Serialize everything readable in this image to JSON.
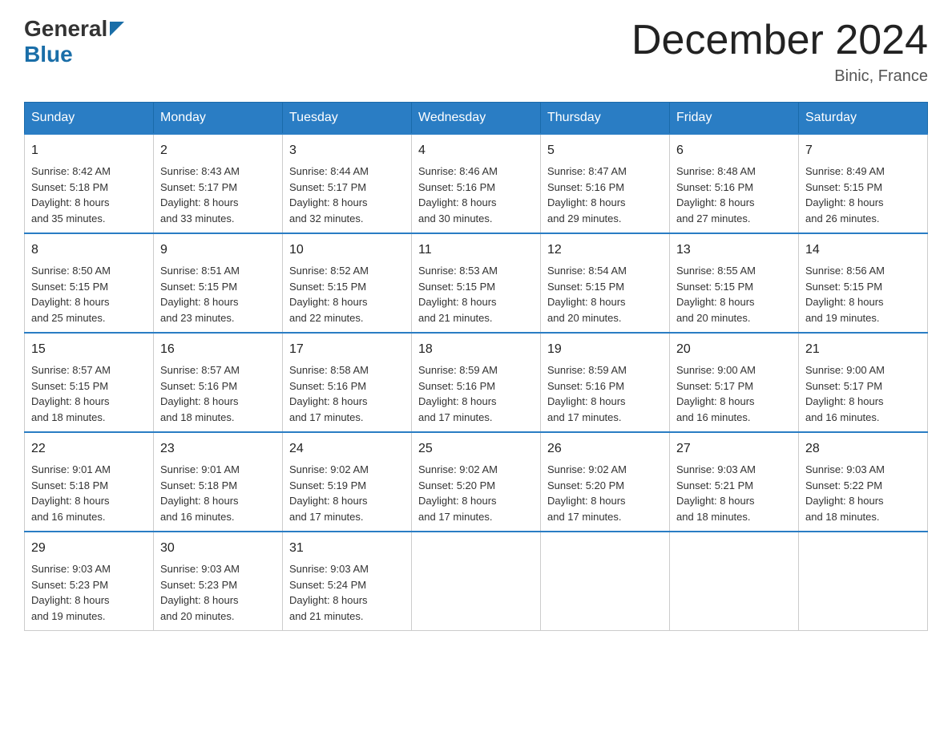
{
  "logo": {
    "general": "General",
    "blue": "Blue"
  },
  "title": "December 2024",
  "location": "Binic, France",
  "days_of_week": [
    "Sunday",
    "Monday",
    "Tuesday",
    "Wednesday",
    "Thursday",
    "Friday",
    "Saturday"
  ],
  "weeks": [
    [
      {
        "day": "1",
        "sunrise": "Sunrise: 8:42 AM",
        "sunset": "Sunset: 5:18 PM",
        "daylight": "Daylight: 8 hours",
        "daylight2": "and 35 minutes."
      },
      {
        "day": "2",
        "sunrise": "Sunrise: 8:43 AM",
        "sunset": "Sunset: 5:17 PM",
        "daylight": "Daylight: 8 hours",
        "daylight2": "and 33 minutes."
      },
      {
        "day": "3",
        "sunrise": "Sunrise: 8:44 AM",
        "sunset": "Sunset: 5:17 PM",
        "daylight": "Daylight: 8 hours",
        "daylight2": "and 32 minutes."
      },
      {
        "day": "4",
        "sunrise": "Sunrise: 8:46 AM",
        "sunset": "Sunset: 5:16 PM",
        "daylight": "Daylight: 8 hours",
        "daylight2": "and 30 minutes."
      },
      {
        "day": "5",
        "sunrise": "Sunrise: 8:47 AM",
        "sunset": "Sunset: 5:16 PM",
        "daylight": "Daylight: 8 hours",
        "daylight2": "and 29 minutes."
      },
      {
        "day": "6",
        "sunrise": "Sunrise: 8:48 AM",
        "sunset": "Sunset: 5:16 PM",
        "daylight": "Daylight: 8 hours",
        "daylight2": "and 27 minutes."
      },
      {
        "day": "7",
        "sunrise": "Sunrise: 8:49 AM",
        "sunset": "Sunset: 5:15 PM",
        "daylight": "Daylight: 8 hours",
        "daylight2": "and 26 minutes."
      }
    ],
    [
      {
        "day": "8",
        "sunrise": "Sunrise: 8:50 AM",
        "sunset": "Sunset: 5:15 PM",
        "daylight": "Daylight: 8 hours",
        "daylight2": "and 25 minutes."
      },
      {
        "day": "9",
        "sunrise": "Sunrise: 8:51 AM",
        "sunset": "Sunset: 5:15 PM",
        "daylight": "Daylight: 8 hours",
        "daylight2": "and 23 minutes."
      },
      {
        "day": "10",
        "sunrise": "Sunrise: 8:52 AM",
        "sunset": "Sunset: 5:15 PM",
        "daylight": "Daylight: 8 hours",
        "daylight2": "and 22 minutes."
      },
      {
        "day": "11",
        "sunrise": "Sunrise: 8:53 AM",
        "sunset": "Sunset: 5:15 PM",
        "daylight": "Daylight: 8 hours",
        "daylight2": "and 21 minutes."
      },
      {
        "day": "12",
        "sunrise": "Sunrise: 8:54 AM",
        "sunset": "Sunset: 5:15 PM",
        "daylight": "Daylight: 8 hours",
        "daylight2": "and 20 minutes."
      },
      {
        "day": "13",
        "sunrise": "Sunrise: 8:55 AM",
        "sunset": "Sunset: 5:15 PM",
        "daylight": "Daylight: 8 hours",
        "daylight2": "and 20 minutes."
      },
      {
        "day": "14",
        "sunrise": "Sunrise: 8:56 AM",
        "sunset": "Sunset: 5:15 PM",
        "daylight": "Daylight: 8 hours",
        "daylight2": "and 19 minutes."
      }
    ],
    [
      {
        "day": "15",
        "sunrise": "Sunrise: 8:57 AM",
        "sunset": "Sunset: 5:15 PM",
        "daylight": "Daylight: 8 hours",
        "daylight2": "and 18 minutes."
      },
      {
        "day": "16",
        "sunrise": "Sunrise: 8:57 AM",
        "sunset": "Sunset: 5:16 PM",
        "daylight": "Daylight: 8 hours",
        "daylight2": "and 18 minutes."
      },
      {
        "day": "17",
        "sunrise": "Sunrise: 8:58 AM",
        "sunset": "Sunset: 5:16 PM",
        "daylight": "Daylight: 8 hours",
        "daylight2": "and 17 minutes."
      },
      {
        "day": "18",
        "sunrise": "Sunrise: 8:59 AM",
        "sunset": "Sunset: 5:16 PM",
        "daylight": "Daylight: 8 hours",
        "daylight2": "and 17 minutes."
      },
      {
        "day": "19",
        "sunrise": "Sunrise: 8:59 AM",
        "sunset": "Sunset: 5:16 PM",
        "daylight": "Daylight: 8 hours",
        "daylight2": "and 17 minutes."
      },
      {
        "day": "20",
        "sunrise": "Sunrise: 9:00 AM",
        "sunset": "Sunset: 5:17 PM",
        "daylight": "Daylight: 8 hours",
        "daylight2": "and 16 minutes."
      },
      {
        "day": "21",
        "sunrise": "Sunrise: 9:00 AM",
        "sunset": "Sunset: 5:17 PM",
        "daylight": "Daylight: 8 hours",
        "daylight2": "and 16 minutes."
      }
    ],
    [
      {
        "day": "22",
        "sunrise": "Sunrise: 9:01 AM",
        "sunset": "Sunset: 5:18 PM",
        "daylight": "Daylight: 8 hours",
        "daylight2": "and 16 minutes."
      },
      {
        "day": "23",
        "sunrise": "Sunrise: 9:01 AM",
        "sunset": "Sunset: 5:18 PM",
        "daylight": "Daylight: 8 hours",
        "daylight2": "and 16 minutes."
      },
      {
        "day": "24",
        "sunrise": "Sunrise: 9:02 AM",
        "sunset": "Sunset: 5:19 PM",
        "daylight": "Daylight: 8 hours",
        "daylight2": "and 17 minutes."
      },
      {
        "day": "25",
        "sunrise": "Sunrise: 9:02 AM",
        "sunset": "Sunset: 5:20 PM",
        "daylight": "Daylight: 8 hours",
        "daylight2": "and 17 minutes."
      },
      {
        "day": "26",
        "sunrise": "Sunrise: 9:02 AM",
        "sunset": "Sunset: 5:20 PM",
        "daylight": "Daylight: 8 hours",
        "daylight2": "and 17 minutes."
      },
      {
        "day": "27",
        "sunrise": "Sunrise: 9:03 AM",
        "sunset": "Sunset: 5:21 PM",
        "daylight": "Daylight: 8 hours",
        "daylight2": "and 18 minutes."
      },
      {
        "day": "28",
        "sunrise": "Sunrise: 9:03 AM",
        "sunset": "Sunset: 5:22 PM",
        "daylight": "Daylight: 8 hours",
        "daylight2": "and 18 minutes."
      }
    ],
    [
      {
        "day": "29",
        "sunrise": "Sunrise: 9:03 AM",
        "sunset": "Sunset: 5:23 PM",
        "daylight": "Daylight: 8 hours",
        "daylight2": "and 19 minutes."
      },
      {
        "day": "30",
        "sunrise": "Sunrise: 9:03 AM",
        "sunset": "Sunset: 5:23 PM",
        "daylight": "Daylight: 8 hours",
        "daylight2": "and 20 minutes."
      },
      {
        "day": "31",
        "sunrise": "Sunrise: 9:03 AM",
        "sunset": "Sunset: 5:24 PM",
        "daylight": "Daylight: 8 hours",
        "daylight2": "and 21 minutes."
      },
      null,
      null,
      null,
      null
    ]
  ]
}
